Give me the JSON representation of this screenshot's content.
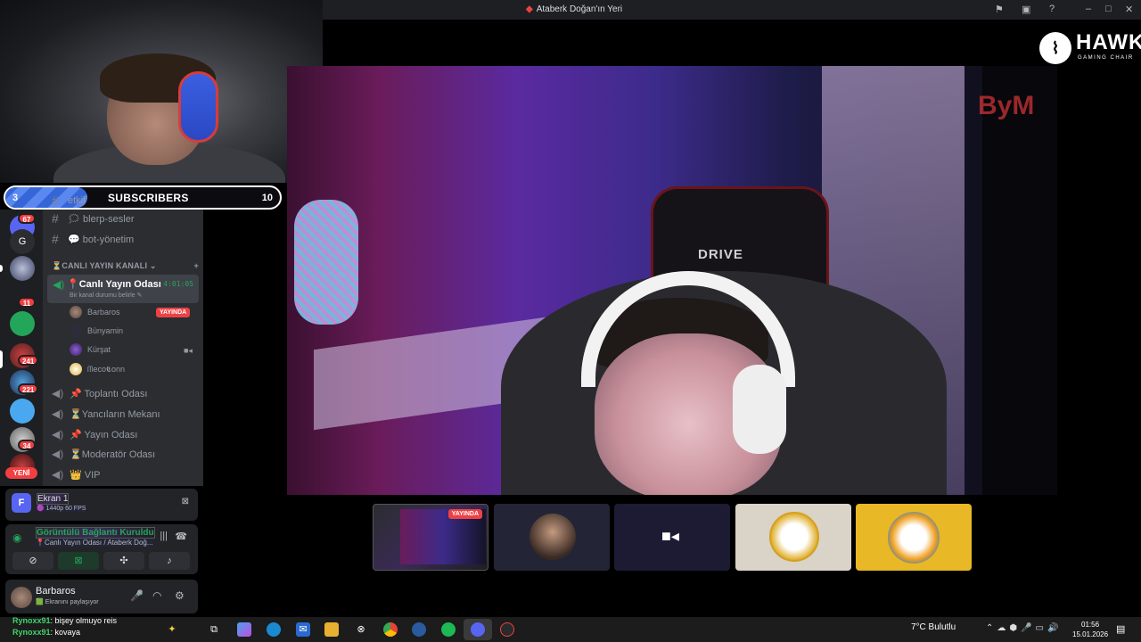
{
  "window": {
    "title": "Ataberk Doğan'ın Yeri",
    "title_icon": "discord-icon"
  },
  "subscribers": {
    "current": "3",
    "label": "SUBSCRIBERS",
    "goal": "10",
    "progress_fraction": 0.3,
    "fill_color": "#3566d8"
  },
  "server_rail": {
    "badges": [
      "67",
      "11",
      "241",
      "221",
      "34"
    ],
    "new_label": "YENİ"
  },
  "channels": {
    "text": [
      {
        "label": "etkil",
        "icon": "hash-icon"
      },
      {
        "label": "🗯 blerp-sesler",
        "icon": "hash-icon"
      },
      {
        "label": "💬 bot-yönetim",
        "icon": "hash-icon"
      }
    ],
    "category": "⏳CANLI YAYIN KANALI",
    "active_voice": {
      "name": "📍Canlı Yayın Odası",
      "status": "Bir kanal durumu belirle",
      "timer": "4:01:05"
    },
    "members": [
      {
        "name": "Barbaros",
        "badge": "YAYINDA"
      },
      {
        "name": "Bünyamin"
      },
      {
        "name": "Kürşat"
      },
      {
        "name": "ᗰeco𝕮onn"
      }
    ],
    "voice": [
      {
        "label": "📌 Toplantı Odası"
      },
      {
        "label": "⏳Yancıların Mekanı"
      },
      {
        "label": "📌 Yayın Odası"
      },
      {
        "label": "⏳Moderatör Odası"
      },
      {
        "label": "👑 VIP"
      }
    ]
  },
  "screen_share": {
    "title": "Ekran 1",
    "quality": "🟣 1440p 60 FPS"
  },
  "voice_connection": {
    "status": "Görüntülü Bağlantı Kuruldu",
    "location": "📍Canlı Yayın Odası / Ataberk Doğ..."
  },
  "user": {
    "name": "Barbaros",
    "status": "🟩 Ekranını paylaşıyor"
  },
  "brand": {
    "name": "HAWK",
    "tagline": "GAMING CHAIR",
    "chair_label": "DRIVE",
    "wall_logo": "ByM"
  },
  "tiles": {
    "live_badge": "YAYINDA"
  },
  "chat": [
    {
      "user": "Rynoxx91",
      "text": ": bişey olmuyo reis"
    },
    {
      "user": "Rynoxx91",
      "text": ": kovaya"
    }
  ],
  "taskbar": {
    "weather": "7°C  Bulutlu",
    "time": "01:56",
    "date": "15.01.2026"
  }
}
